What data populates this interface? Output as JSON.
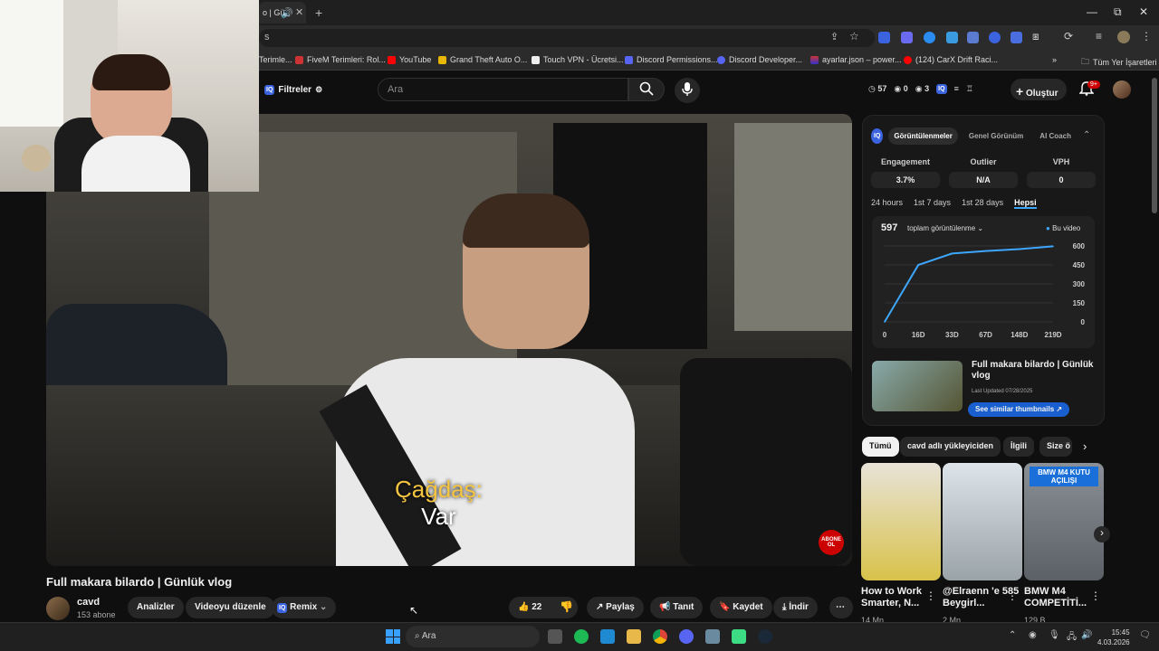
{
  "browser": {
    "tab_title": "o | Gü",
    "address": "s",
    "bookmarks": [
      "Terimle...",
      "FiveM Terimleri: Rol...",
      "YouTube",
      "Grand Theft Auto O...",
      "Touch VPN - Ücretsi...",
      "Discord Permissions...",
      "Discord Developer...",
      "ayarlar.json – power...",
      "(124) CarX Drift Raci..."
    ],
    "all_bookmarks": "Tüm Yer İşaretleri"
  },
  "header": {
    "filters_label": "Filtreler",
    "search_placeholder": "Ara",
    "stat_views": "57",
    "stat_a": "0",
    "stat_b": "3",
    "create_label": "Oluştur",
    "notif_badge": "9+"
  },
  "video": {
    "subtitle_top": "Çağdaş:",
    "subtitle_bottom": "Var",
    "subscribe_badge": "ABONE OL",
    "title": "Full makara bilardo | Günlük vlog",
    "channel": "cavd",
    "subscribers": "153 abone",
    "buttons": {
      "analytics": "Analizler",
      "edit": "Videoyu düzenle",
      "remix": "Remix",
      "likes": "22",
      "share": "Paylaş",
      "promote": "Tanıt",
      "save": "Kaydet",
      "download": "İndir"
    }
  },
  "panel": {
    "tabs": [
      "Görüntülenmeler",
      "Genel Görünüm",
      "AI Coach"
    ],
    "metrics": [
      {
        "label": "Engagement",
        "value": "3.7%"
      },
      {
        "label": "Outlier",
        "value": "N/A"
      },
      {
        "label": "VPH",
        "value": "0"
      }
    ],
    "ranges": [
      "24 hours",
      "1st 7 days",
      "1st 28 days",
      "Hepsi"
    ],
    "views_total": "597",
    "views_label": "toplam görüntülenme",
    "series_label": "Bu video",
    "card_title": "Full makara bilardo | Günlük vlog",
    "card_updated": "Last Updated 07/28/2025",
    "similar_button": "See similar thumbnails"
  },
  "chart_data": {
    "type": "line",
    "x": [
      "0",
      "16D",
      "33D",
      "67D",
      "148D",
      "219D"
    ],
    "yticks": [
      0,
      150,
      300,
      450,
      600
    ],
    "ylim": [
      0,
      600
    ],
    "series": [
      {
        "name": "Bu video",
        "values": [
          0,
          450,
          540,
          560,
          575,
          597
        ]
      }
    ],
    "grid": true,
    "legend": "top-right"
  },
  "chips": [
    "Tümü",
    "cavd adlı yükleyiciden",
    "İlgili",
    "Size ö"
  ],
  "related": [
    {
      "title": "How to Work Smarter, N...",
      "views": "14 Mn",
      "thumb_text": "",
      "color": "#d8c24a"
    },
    {
      "title": "@Elraenn  'e 585 Beygirl...",
      "views": "2 Mn",
      "thumb_text": "",
      "color": "#9aa3a8"
    },
    {
      "title": "BMW M4 COMPETİTİ...",
      "views": "129 B",
      "thumb_text": "BMW M4 KUTU AÇILIŞI",
      "color": "#7b8288"
    }
  ],
  "taskbar": {
    "search": "Ara",
    "time": "15:45",
    "date": "4.03.2026"
  }
}
